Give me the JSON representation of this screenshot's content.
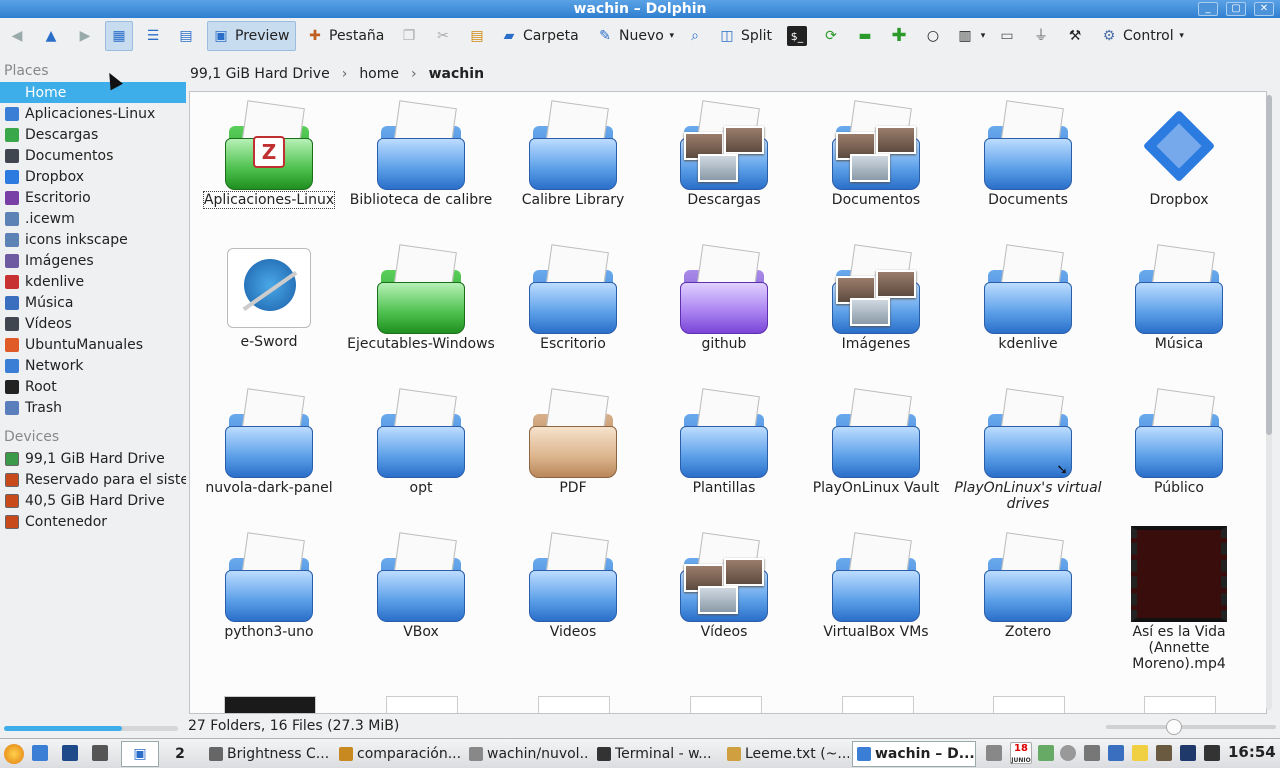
{
  "window": {
    "title": "wachin – Dolphin",
    "min": "_",
    "max": "▢",
    "close": "✕"
  },
  "toolbar": {
    "preview": "Preview",
    "tab": "Pestaña",
    "folder": "Carpeta",
    "new": "Nuevo",
    "split": "Split",
    "control": "Control"
  },
  "breadcrumb": {
    "drive": "99,1 GiB Hard Drive",
    "home": "home",
    "current": "wachin"
  },
  "places": {
    "title": "Places",
    "items": [
      "Home",
      "Aplicaciones-Linux",
      "Descargas",
      "Documentos",
      "Dropbox",
      "Escritorio",
      ".icewm",
      "icons inkscape",
      "Imágenes",
      "kdenlive",
      "Música",
      "Vídeos",
      "UbuntuManuales",
      "Network",
      "Root",
      "Trash"
    ],
    "icon_colors": [
      "#3daee9",
      "#3a7fd5",
      "#3aa84a",
      "#3f4650",
      "#2b7be0",
      "#7a3fa6",
      "#5d82b5",
      "#5d82b5",
      "#6e5aa0",
      "#c83131",
      "#3a6fbf",
      "#3f4650",
      "#e05a28",
      "#3a7fd5",
      "#222222",
      "#5b7fbd"
    ]
  },
  "devices": {
    "title": "Devices",
    "items": [
      "99,1 GiB Hard Drive",
      "Reservado para el sistema",
      "40,5 GiB Hard Drive",
      "Contenedor"
    ]
  },
  "files": [
    {
      "name": "Aplicaciones-Linux",
      "kind": "zim"
    },
    {
      "name": "Biblioteca de calibre",
      "kind": "folder"
    },
    {
      "name": "Calibre Library",
      "kind": "folder"
    },
    {
      "name": "Descargas",
      "kind": "photos"
    },
    {
      "name": "Documentos",
      "kind": "photos"
    },
    {
      "name": "Documents",
      "kind": "folder"
    },
    {
      "name": "Dropbox",
      "kind": "dropbox"
    },
    {
      "name": "e-Sword",
      "kind": "esword"
    },
    {
      "name": "Ejecutables-Windows",
      "kind": "green"
    },
    {
      "name": "Escritorio",
      "kind": "folder"
    },
    {
      "name": "github",
      "kind": "purple"
    },
    {
      "name": "Imágenes",
      "kind": "photos"
    },
    {
      "name": "kdenlive",
      "kind": "folder"
    },
    {
      "name": "Música",
      "kind": "folder"
    },
    {
      "name": "nuvola-dark-panel",
      "kind": "folder"
    },
    {
      "name": "opt",
      "kind": "folder"
    },
    {
      "name": "PDF",
      "kind": "brown"
    },
    {
      "name": "Plantillas",
      "kind": "folder"
    },
    {
      "name": "PlayOnLinux Vault",
      "kind": "folder"
    },
    {
      "name": "PlayOnLinux's virtual drives",
      "kind": "link"
    },
    {
      "name": "Público",
      "kind": "folder"
    },
    {
      "name": "python3-uno",
      "kind": "folder"
    },
    {
      "name": "VBox",
      "kind": "folder"
    },
    {
      "name": "Videos",
      "kind": "folder"
    },
    {
      "name": "Vídeos",
      "kind": "photos"
    },
    {
      "name": "VirtualBox VMs",
      "kind": "folder"
    },
    {
      "name": "Zotero",
      "kind": "folder"
    },
    {
      "name": "Así es la Vida (Annette Moreno).mp4",
      "kind": "video"
    }
  ],
  "status": {
    "text": "27 Folders, 16 Files (27.3 MiB)",
    "free_space_fraction": 0.68
  },
  "taskbar": {
    "desktop_number": "2",
    "tasks": [
      "Brightness C...",
      "comparación...",
      "wachin/nuvol...",
      "Terminal - w...",
      "Leeme.txt (~...",
      "wachin – D..."
    ],
    "active": "wachin – D...",
    "calendar_day": "18",
    "calendar_month": "JUNIO",
    "clock": "16:54"
  }
}
